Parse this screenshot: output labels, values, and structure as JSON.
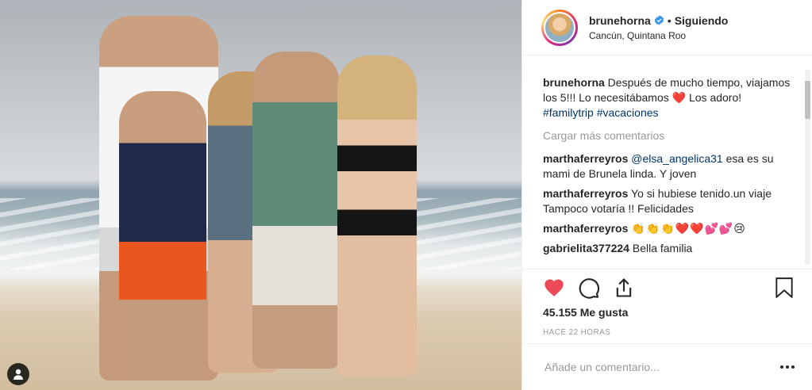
{
  "header": {
    "username": "brunehorna",
    "separator": "•",
    "follow_label": "Siguiendo",
    "location": "Cancún, Quintana Roo"
  },
  "caption": {
    "username": "brunehorna",
    "text_part1": "Después de mucho tiempo, viajamos los 5!!! Lo necesitábamos",
    "heart": "❤️",
    "text_part2": "Los adoro!",
    "hashtags": [
      "#familytrip",
      "#vacaciones"
    ]
  },
  "load_more_label": "Cargar más comentarios",
  "comments": [
    {
      "user": "marthaferreyros",
      "mention": "@elsa_angelica31",
      "text": "esa es su mami de Brunela linda. Y joven"
    },
    {
      "user": "marthaferreyros",
      "mention": "",
      "text": "Yo si hubiese tenido.un viaje Tampoco votaría !! Felicidades"
    },
    {
      "user": "marthaferreyros",
      "mention": "",
      "text": "👏👏👏❤️❤️💕💕😢"
    },
    {
      "user": "gabrielita377224",
      "mention": "",
      "text": "Bella familia"
    }
  ],
  "likes_label": "45.155 Me gusta",
  "timestamp": "HACE 22 HORAS",
  "comment_input_placeholder": "Añade un comentario...",
  "colors": {
    "like_active": "#ed4956",
    "verified": "#3897f0",
    "hashtag": "#003569"
  },
  "icons": [
    "user-tag-icon",
    "verified-icon",
    "heart-icon",
    "comment-icon",
    "share-icon",
    "bookmark-icon",
    "more-options-icon"
  ]
}
